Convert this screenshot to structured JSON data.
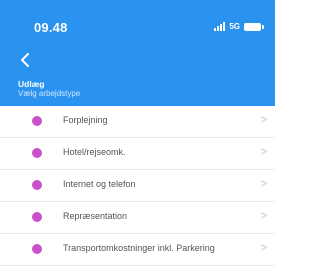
{
  "status_bar": {
    "time": "09.48",
    "network": "5G"
  },
  "header": {
    "title": "Udlæg",
    "subtitle": "Vælg arbejdstype",
    "back_icon": "chevron-left-icon"
  },
  "colors": {
    "header_bg": "#2a93f0",
    "dot": "#cc4fcc"
  },
  "list": {
    "items": [
      {
        "label": "Forplejning"
      },
      {
        "label": "Hotel/rejseomk."
      },
      {
        "label": "Internet og telefon"
      },
      {
        "label": "Repræsentation"
      },
      {
        "label": "Transportomkostninger inkl. Parkering"
      }
    ]
  }
}
